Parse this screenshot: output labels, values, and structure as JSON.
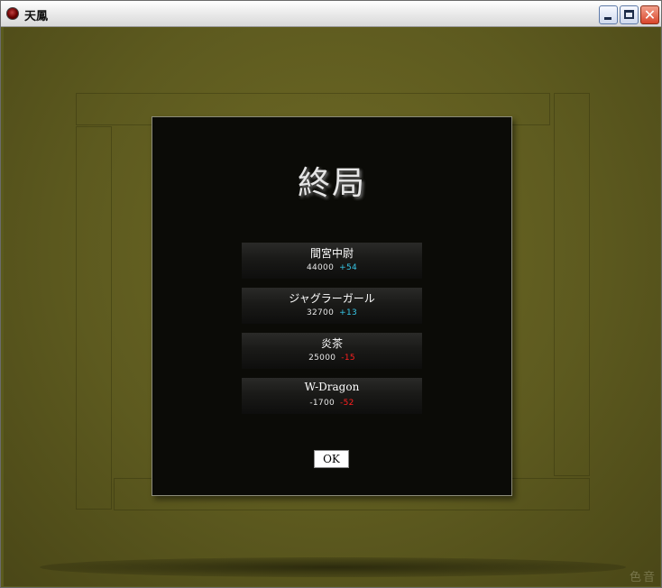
{
  "window": {
    "title": "天鳳",
    "controls": {
      "minimize": "minimize",
      "maximize": "maximize",
      "close": "✕"
    }
  },
  "dialog": {
    "title": "終局",
    "results": [
      {
        "name": "間宮中尉",
        "score": "44000",
        "delta": "+54",
        "delta_sign": "positive"
      },
      {
        "name": "ジャグラーガール",
        "score": "32700",
        "delta": "+13",
        "delta_sign": "positive"
      },
      {
        "name": "炎茶",
        "score": "25000",
        "delta": "-15",
        "delta_sign": "negative"
      },
      {
        "name": "W-Dragon",
        "score": "-1700",
        "delta": "-52",
        "delta_sign": "negative"
      }
    ],
    "ok_label": "OK"
  },
  "watermark": "色音",
  "colors": {
    "table_felt": "#5d5a1f",
    "dialog_bg": "#0b0b07",
    "positive_delta": "#36c6e6",
    "negative_delta": "#ff2020"
  }
}
